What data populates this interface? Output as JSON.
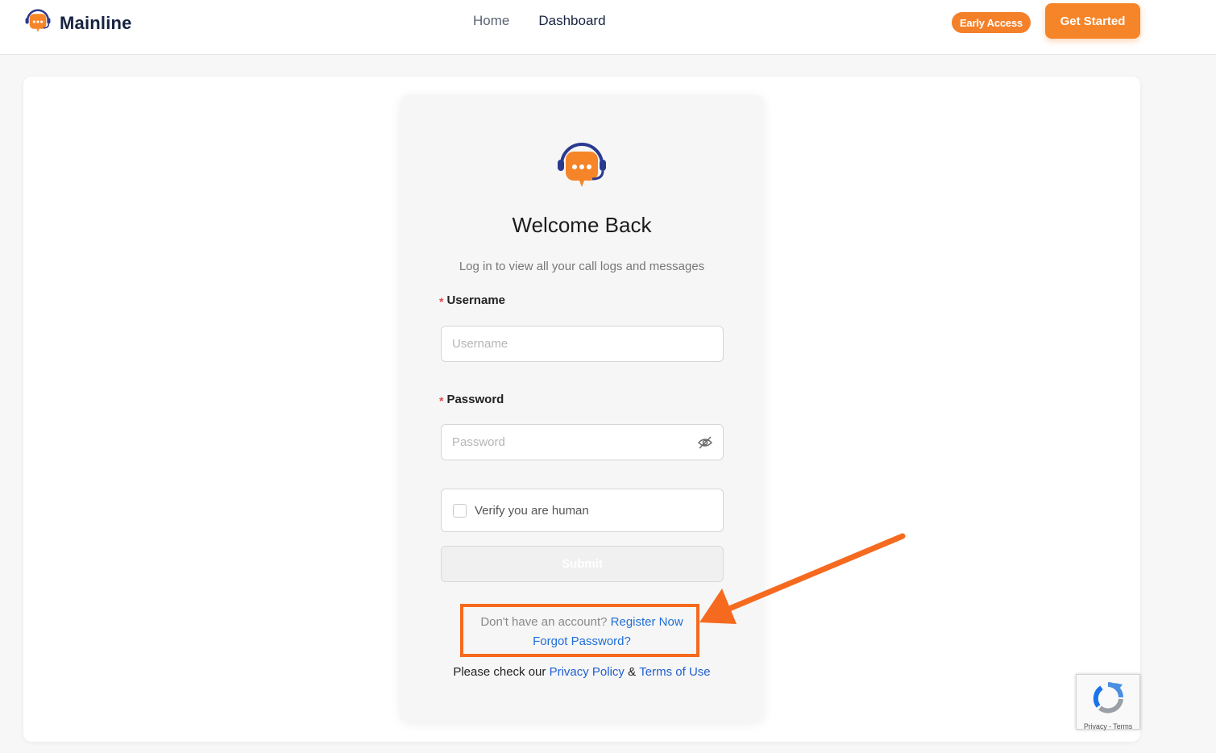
{
  "header": {
    "brand": "Mainline",
    "nav": [
      {
        "label": "Home"
      },
      {
        "label": "Dashboard"
      }
    ],
    "early_access": "Early Access",
    "get_started": "Get Started"
  },
  "login": {
    "title": "Welcome Back",
    "subtitle": "Log in to view all your call logs and messages",
    "username_label": "Username",
    "username_placeholder": "Username",
    "password_label": "Password",
    "password_placeholder": "Password",
    "required_mark": "*",
    "captcha_label": "Verify you are human",
    "submit": "Submit",
    "no_account_text": "Don't have an account?",
    "register_link": "Register Now",
    "forgot_link": "Forgot Password?",
    "policy_prefix": "Please check our",
    "privacy_link": "Privacy Policy",
    "amp": "&",
    "terms_link": "Terms of Use"
  },
  "recaptcha": {
    "links": "Privacy - Terms"
  },
  "colors": {
    "brand_orange": "#f68529",
    "brand_navy": "#15233f",
    "link_blue": "#1f6fd6",
    "annotation": "#f56a1f"
  },
  "icons": [
    "headset-chat-logo-icon",
    "eye-off-icon",
    "recaptcha-icon",
    "annotation-arrow-icon"
  ]
}
